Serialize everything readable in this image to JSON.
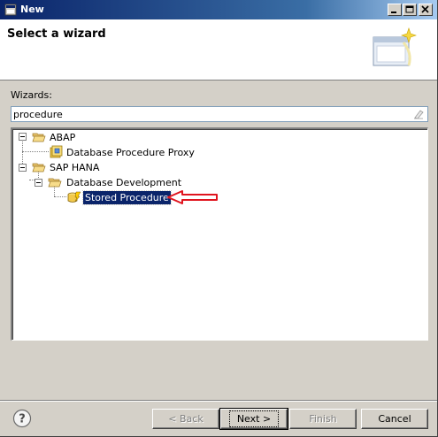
{
  "window": {
    "title": "New"
  },
  "header": {
    "title": "Select a wizard"
  },
  "filter": {
    "label": "Wizards:",
    "value": "procedure"
  },
  "tree": {
    "abap": {
      "label": "ABAP",
      "child": "Database Procedure Proxy"
    },
    "hana": {
      "label": "SAP HANA",
      "folder": "Database Development",
      "item": "Stored Procedure"
    }
  },
  "buttons": {
    "back": "< Back",
    "next": "Next >",
    "finish": "Finish",
    "cancel": "Cancel"
  },
  "colors": {
    "selection": "#0a246a",
    "annotation_arrow": "#e0141e"
  }
}
